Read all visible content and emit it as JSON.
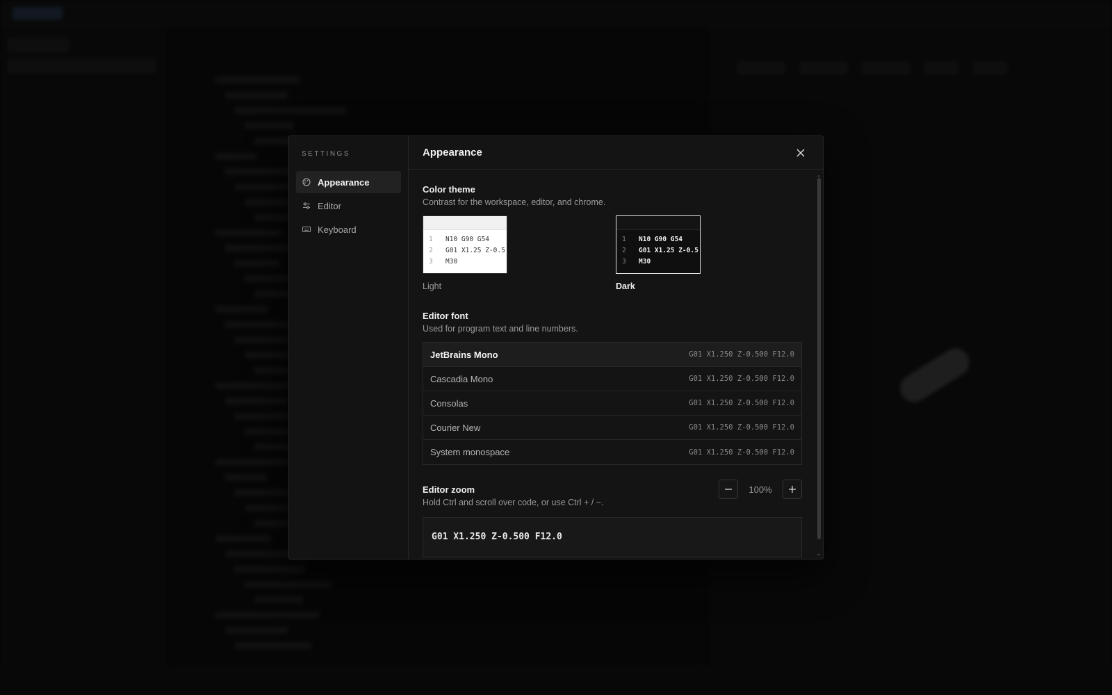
{
  "settings": {
    "heading": "SETTINGS",
    "nav": [
      {
        "label": "Appearance",
        "icon": "palette-icon",
        "active": true
      },
      {
        "label": "Editor",
        "icon": "sliders-icon",
        "active": false
      },
      {
        "label": "Keyboard",
        "icon": "keyboard-icon",
        "active": false
      }
    ]
  },
  "panel": {
    "title": "Appearance",
    "close_icon": "close-icon"
  },
  "color_theme": {
    "title": "Color theme",
    "description": "Contrast for the workspace, editor, and chrome.",
    "selected": "Dark",
    "options": [
      {
        "label": "Light",
        "lines": [
          {
            "n": "1",
            "code": "N10 G90 G54"
          },
          {
            "n": "2",
            "code": "G01 X1.25 Z-0.5"
          },
          {
            "n": "3",
            "code": "M30"
          }
        ]
      },
      {
        "label": "Dark",
        "lines": [
          {
            "n": "1",
            "code": "N10 G90 G54"
          },
          {
            "n": "2",
            "code": "G01 X1.25 Z-0.5"
          },
          {
            "n": "3",
            "code": "M30"
          }
        ]
      }
    ]
  },
  "editor_font": {
    "title": "Editor font",
    "description": "Used for program text and line numbers.",
    "selected": "JetBrains Mono",
    "options": [
      {
        "name": "JetBrains Mono",
        "sample": "G01 X1.250 Z-0.500 F12.0"
      },
      {
        "name": "Cascadia Mono",
        "sample": "G01 X1.250 Z-0.500 F12.0"
      },
      {
        "name": "Consolas",
        "sample": "G01 X1.250 Z-0.500 F12.0"
      },
      {
        "name": "Courier New",
        "sample": "G01 X1.250 Z-0.500 F12.0"
      },
      {
        "name": "System monospace",
        "sample": "G01 X1.250 Z-0.500 F12.0"
      }
    ]
  },
  "editor_zoom": {
    "title": "Editor zoom",
    "description": "Hold Ctrl and scroll over code, or use Ctrl + / −.",
    "value": "100%",
    "decrease_icon": "minus-icon",
    "increase_icon": "plus-icon",
    "preview": "G01 X1.250 Z-0.500 F12.0"
  },
  "colors": {
    "backdrop": "#060606",
    "modal_bg": "#141414",
    "border": "#2a2a2a",
    "text_primary": "#f0f0f0",
    "text_secondary": "#9a9a9a"
  }
}
